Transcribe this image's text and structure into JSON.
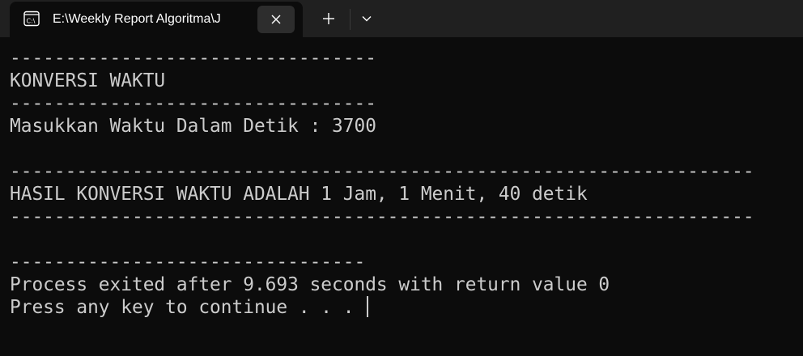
{
  "tab": {
    "title": "E:\\Weekly Report Algoritma\\J",
    "icon": "terminal-icon",
    "close_icon": "close-icon"
  },
  "titlebar": {
    "new_tab_icon": "plus-icon",
    "dropdown_icon": "chevron-down-icon"
  },
  "console": {
    "lines": [
      "---------------------------------",
      "KONVERSI WAKTU",
      "---------------------------------",
      "Masukkan Waktu Dalam Detik : 3700",
      "",
      "-------------------------------------------------------------------",
      "HASIL KONVERSI WAKTU ADALAH 1 Jam, 1 Menit, 40 detik",
      "-------------------------------------------------------------------",
      "",
      "--------------------------------",
      "Process exited after 9.693 seconds with return value 0",
      "Press any key to continue . . . "
    ]
  },
  "colors": {
    "background": "#0c0c0c",
    "titlebar": "#202020",
    "text": "#cccccc"
  }
}
